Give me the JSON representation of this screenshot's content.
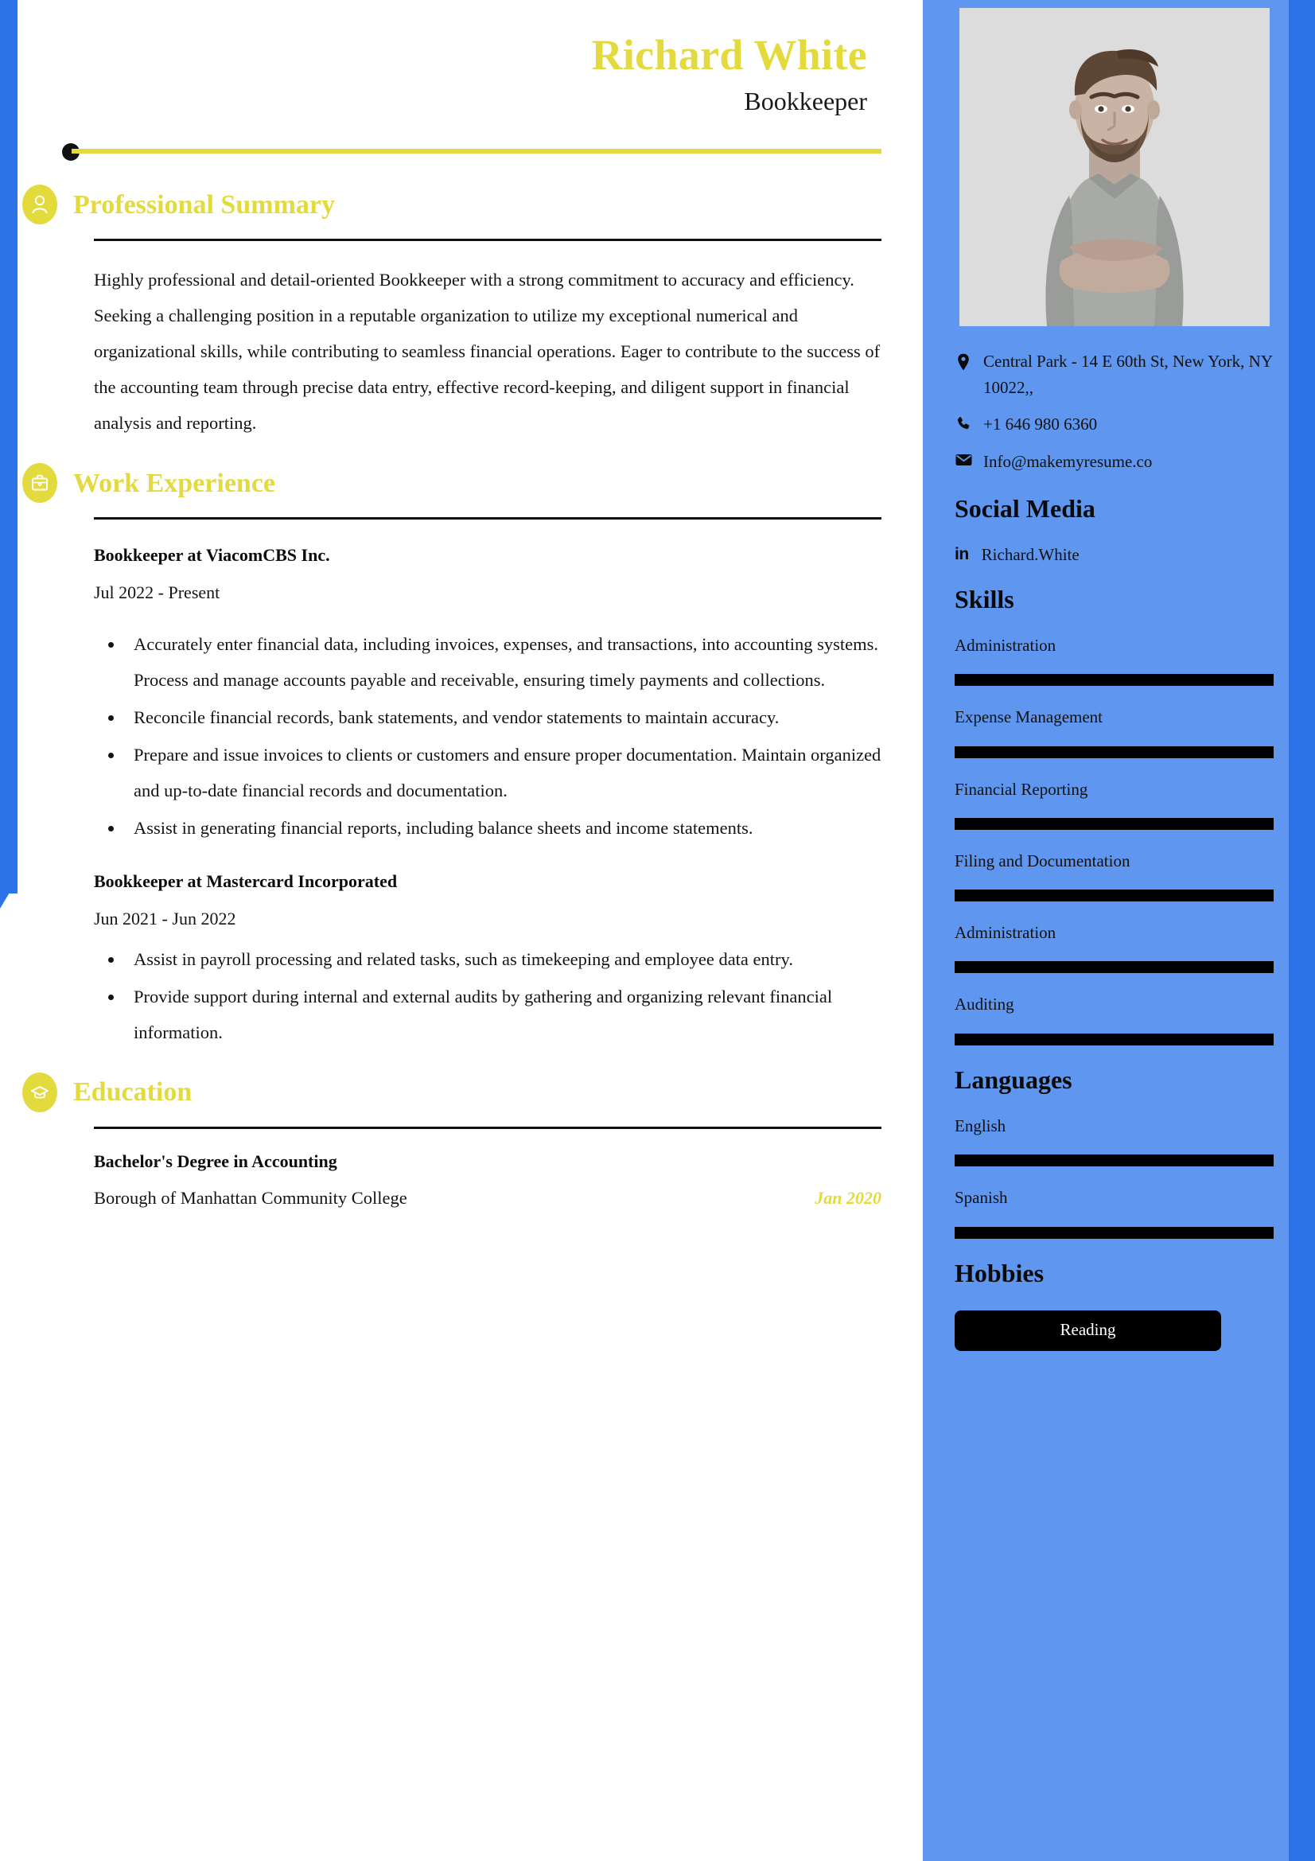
{
  "theme": {
    "accent_yellow": "#e3da3e",
    "sidebar_blue": "#5f96ef",
    "stripe_blue": "#2d73e8",
    "bar_black": "#000000"
  },
  "header": {
    "name": "Richard White",
    "role": "Bookkeeper"
  },
  "sections": {
    "summary": {
      "icon": "person-icon",
      "title": "Professional Summary",
      "text": "Highly professional and detail-oriented Bookkeeper with a strong commitment to accuracy and efficiency. Seeking a challenging position in a reputable organization to utilize my exceptional numerical and organizational skills, while contributing to seamless financial operations. Eager to contribute to the success of the accounting team through precise data entry, effective record-keeping, and diligent support in financial analysis and reporting."
    },
    "experience": {
      "icon": "briefcase-icon",
      "title": "Work Experience",
      "jobs": [
        {
          "title": "Bookkeeper at ViacomCBS Inc.",
          "date": "Jul 2022 - Present",
          "bullets": [
            "Accurately enter financial data, including invoices, expenses, and transactions, into accounting systems. Process and manage accounts payable and receivable, ensuring timely payments and collections.",
            "Reconcile financial records, bank statements, and vendor statements to maintain accuracy.",
            "Prepare and issue invoices to clients or customers and ensure proper documentation. Maintain organized and up-to-date financial records and documentation.",
            "Assist in generating financial reports, including balance sheets and income statements."
          ]
        },
        {
          "title": "Bookkeeper at Mastercard Incorporated",
          "date": "Jun 2021 - Jun 2022",
          "bullets": [
            "Assist in payroll processing and related tasks, such as timekeeping and employee data entry.",
            "Provide support during internal and external audits by gathering and organizing relevant financial information."
          ]
        }
      ]
    },
    "education": {
      "icon": "graduation-cap-icon",
      "title": "Education",
      "entries": [
        {
          "degree": "Bachelor's Degree in Accounting",
          "school": "Borough of Manhattan Community College",
          "date": "Jan 2020"
        }
      ]
    }
  },
  "sidebar": {
    "photo_alt": "profile-photo",
    "contact": [
      {
        "icon": "location-pin-icon",
        "text": "Central Park - 14 E 60th St, New York, NY 10022,,"
      },
      {
        "icon": "phone-icon",
        "text": "+1 646 980 6360"
      },
      {
        "icon": "envelope-icon",
        "text": "Info@makemyresume.co"
      }
    ],
    "social": {
      "title": "Social Media",
      "items": [
        {
          "icon": "linkedin-icon",
          "icon_text": "in",
          "handle": "Richard.White"
        }
      ]
    },
    "skills": {
      "title": "Skills",
      "items": [
        {
          "label": "Administration",
          "level": 100
        },
        {
          "label": "Expense Management",
          "level": 100
        },
        {
          "label": "Financial Reporting",
          "level": 100
        },
        {
          "label": "Filing and Documentation",
          "level": 100
        },
        {
          "label": "Administration",
          "level": 100
        },
        {
          "label": "Auditing",
          "level": 100
        }
      ]
    },
    "languages": {
      "title": "Languages",
      "items": [
        {
          "label": "English",
          "level": 100
        },
        {
          "label": "Spanish",
          "level": 100
        }
      ]
    },
    "hobbies": {
      "title": "Hobbies",
      "items": [
        {
          "label": "Reading"
        }
      ]
    }
  }
}
